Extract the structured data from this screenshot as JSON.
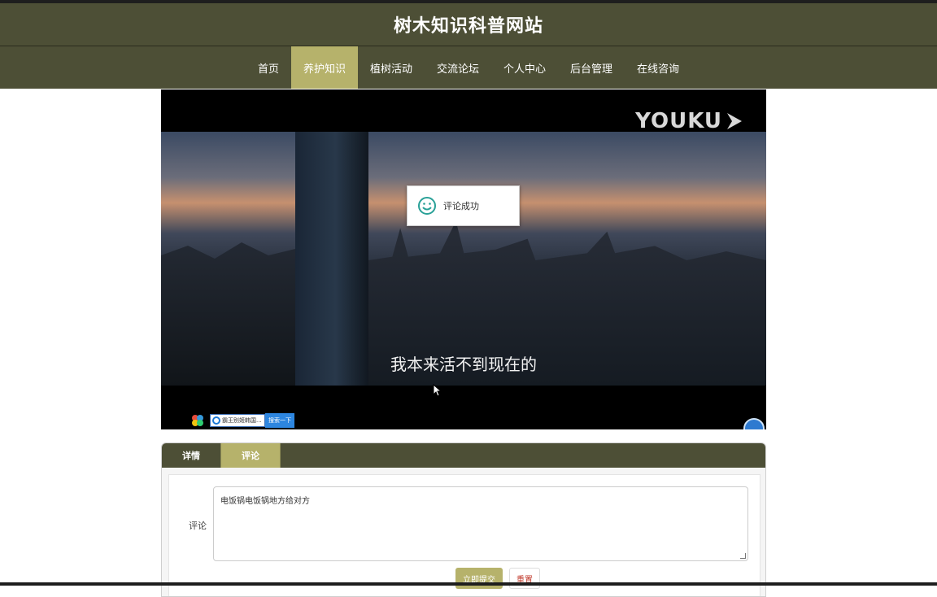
{
  "site": {
    "title": "树木知识科普网站"
  },
  "nav": {
    "items": [
      {
        "label": "首页"
      },
      {
        "label": "养护知识"
      },
      {
        "label": "植树活动"
      },
      {
        "label": "交流论坛"
      },
      {
        "label": "个人中心"
      },
      {
        "label": "后台管理"
      },
      {
        "label": "在线咨询"
      }
    ],
    "active_index": 1
  },
  "video": {
    "logo": "YOUKU",
    "subtitle": "我本来活不到现在的",
    "toast": {
      "icon": "smile-icon",
      "text": "评论成功"
    },
    "ie_bar": {
      "input_text": "霸王别姬韩国...",
      "button_label": "搜索一下"
    }
  },
  "tabs": {
    "items": [
      {
        "label": "详情"
      },
      {
        "label": "评论"
      }
    ],
    "active_index": 1
  },
  "comment_form": {
    "label": "评论",
    "value": "电饭锅电饭锅地方给对方",
    "submit_label": "立即提交",
    "reset_label": "重置"
  },
  "colors": {
    "header_bg": "#4d4f36",
    "accent": "#b6b26b",
    "reset_text": "#c0392b"
  }
}
